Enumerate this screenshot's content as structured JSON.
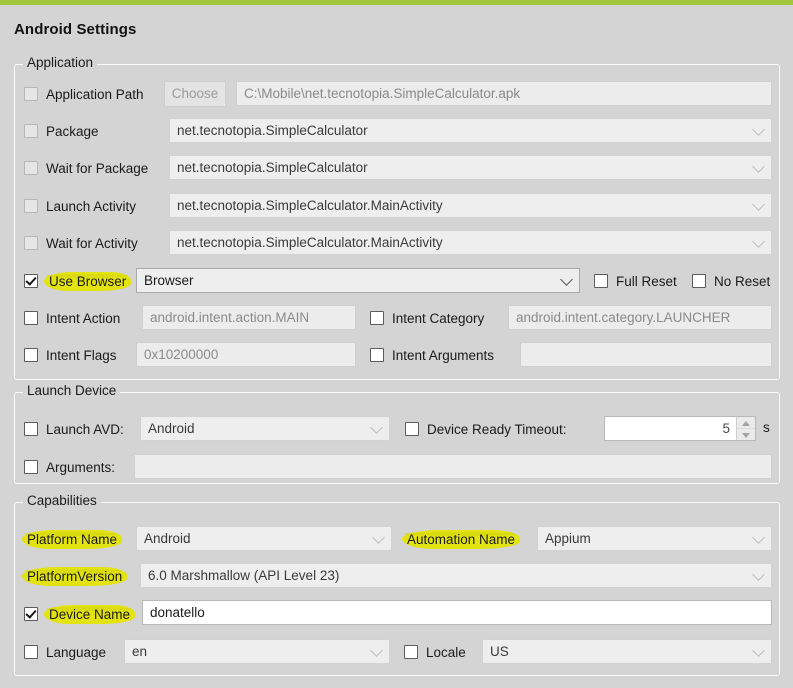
{
  "window": {
    "title": "Android Settings",
    "accent_color": "#a2c63f",
    "background_color": "#d4d4d4",
    "highlight_color": "#e3e312"
  },
  "application": {
    "legend": "Application",
    "rows": {
      "application_path": {
        "label": "Application Path",
        "checked": false,
        "enabled": false,
        "button_label": "Choose",
        "value": "C:\\Mobile\\net.tecnotopia.SimpleCalculator.apk"
      },
      "package": {
        "label": "Package",
        "checked": false,
        "enabled": false,
        "value": "net.tecnotopia.SimpleCalculator"
      },
      "wait_for_package": {
        "label": "Wait for Package",
        "checked": false,
        "enabled": false,
        "value": "net.tecnotopia.SimpleCalculator"
      },
      "launch_activity": {
        "label": "Launch Activity",
        "checked": false,
        "enabled": false,
        "value": "net.tecnotopia.SimpleCalculator.MainActivity"
      },
      "wait_for_activity": {
        "label": "Wait for Activity",
        "checked": false,
        "enabled": false,
        "value": "net.tecnotopia.SimpleCalculator.MainActivity"
      },
      "use_browser": {
        "label": "Use Browser",
        "checked": true,
        "enabled": true,
        "highlighted": true,
        "value": "Browser"
      },
      "full_reset": {
        "label": "Full Reset",
        "checked": false
      },
      "no_reset": {
        "label": "No Reset",
        "checked": false
      },
      "intent_action": {
        "label": "Intent Action",
        "checked": false,
        "value": "android.intent.action.MAIN"
      },
      "intent_category": {
        "label": "Intent Category",
        "checked": false,
        "value": "android.intent.category.LAUNCHER"
      },
      "intent_flags": {
        "label": "Intent Flags",
        "checked": false,
        "value": "0x10200000"
      },
      "intent_arguments": {
        "label": "Intent Arguments",
        "checked": false,
        "value": ""
      }
    }
  },
  "launch_device": {
    "legend": "Launch Device",
    "rows": {
      "launch_avd": {
        "label": "Launch AVD:",
        "checked": false,
        "value": "Android"
      },
      "device_ready_timeout": {
        "label": "Device Ready Timeout:",
        "checked": false,
        "value": "5",
        "unit": "s"
      },
      "arguments": {
        "label": "Arguments:",
        "checked": false,
        "value": ""
      }
    }
  },
  "capabilities": {
    "legend": "Capabilities",
    "rows": {
      "platform_name": {
        "label": "Platform Name",
        "highlighted": true,
        "value": "Android"
      },
      "automation_name": {
        "label": "Automation Name",
        "highlighted": true,
        "value": "Appium"
      },
      "platform_version": {
        "label": "PlatformVersion",
        "highlighted": true,
        "value": "6.0 Marshmallow (API Level 23)"
      },
      "device_name": {
        "label": "Device Name",
        "checked": true,
        "highlighted": true,
        "value": "donatello"
      },
      "language": {
        "label": "Language",
        "checked": false,
        "value": "en"
      },
      "locale": {
        "label": "Locale",
        "checked": false,
        "value": "US"
      }
    }
  },
  "icons": {
    "chevron_down": "chevron-down-icon",
    "spinner_up": "spinner-up-icon",
    "spinner_down": "spinner-down-icon",
    "checkmark": "checkmark-icon"
  }
}
